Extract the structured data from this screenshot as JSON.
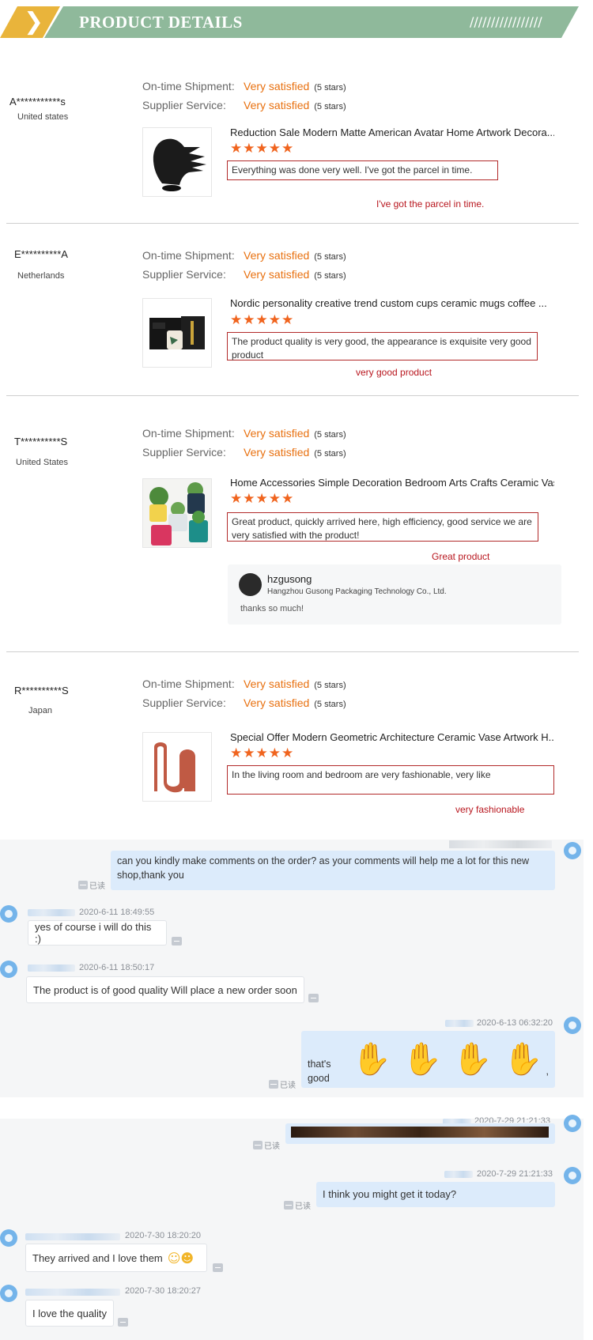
{
  "header": {
    "title": "PRODUCT DETAILS",
    "chevron": "❯",
    "stripes": "/////////////////"
  },
  "rating_labels": {
    "shipment": "On-time Shipment:",
    "service": "Supplier Service:"
  },
  "reviews": [
    {
      "name": "A***********s",
      "country": "United states",
      "shipment": "Very satisfied",
      "shipment_stars": "(5 stars)",
      "service": "Very satisfied",
      "service_stars": "(5 stars)",
      "product": "Reduction Sale Modern Matte American Avatar Home Artwork Decora...",
      "stars": "★★★★★",
      "comment": "Everything was done very well. I've got the parcel in time.",
      "annotation": "I've got the parcel in time."
    },
    {
      "name": "E**********A",
      "country": "Netherlands",
      "shipment": "Very satisfied",
      "shipment_stars": "(5 stars)",
      "service": "Very satisfied",
      "service_stars": "(5 stars)",
      "product": "Nordic personality creative trend custom cups ceramic mugs coffee ...",
      "stars": "★★★★★",
      "comment": "The product quality is very good, the appearance is exquisite very good product",
      "annotation": "very good product"
    },
    {
      "name": "T**********S",
      "country": "United States",
      "shipment": "Very satisfied",
      "shipment_stars": "(5 stars)",
      "service": "Very satisfied",
      "service_stars": "(5 stars)",
      "product": "Home Accessories Simple Decoration Bedroom Arts Crafts Ceramic Vas...",
      "stars": "★★★★★",
      "comment": "Great product, quickly arrived here, high efficiency, good service we are very satisfied with the product!",
      "annotation": "Great product",
      "reply": {
        "name": "hzgusong",
        "company": "Hangzhou Gusong Packaging Technology Co., Ltd.",
        "text": "thanks so much!"
      }
    },
    {
      "name": "R**********S",
      "country": "Japan",
      "shipment": "Very satisfied",
      "shipment_stars": "(5 stars)",
      "service": "Very satisfied",
      "service_stars": "(5 stars)",
      "product": "Special Offer Modern Geometric Architecture Ceramic Vase Artwork H...",
      "stars": "★★★★★",
      "comment": "In the living room and bedroom are very fashionable, very like",
      "annotation": "very fashionable"
    }
  ],
  "chat1": {
    "read_label": "已读",
    "msg1": "can you kindly make comments on the order? as your comments will help me a lot for this new shop,thank you",
    "msg2_time": "2020-6-11 18:49:55",
    "msg2": "yes of course i will do this :)",
    "msg3_time": "2020-6-11 18:50:17",
    "msg3": "The product is of good quality  Will place a new order soon",
    "msg4_time": "2020-6-13 06:32:20",
    "msg4": "that's good",
    "msg4_tail": ","
  },
  "chat2": {
    "read_label": "已读",
    "msg1_time": "2020-7-29 21:21:33",
    "msg2_time": "2020-7-29 21:21:33",
    "msg2": "I think you might get it today?",
    "msg3_time": "2020-7-30 18:20:20",
    "msg3": "They arrived and I love them",
    "msg3_emojis": "☺☻",
    "msg4_time": "2020-7-30 18:20:27",
    "msg4": "I love the quality"
  },
  "colors": {
    "banner_green": "#8fb99b",
    "banner_yellow": "#e9b43b",
    "rating_orange": "#e8700f",
    "annotation_red": "#b8161e",
    "chat_out_bubble": "#dcebfb"
  }
}
